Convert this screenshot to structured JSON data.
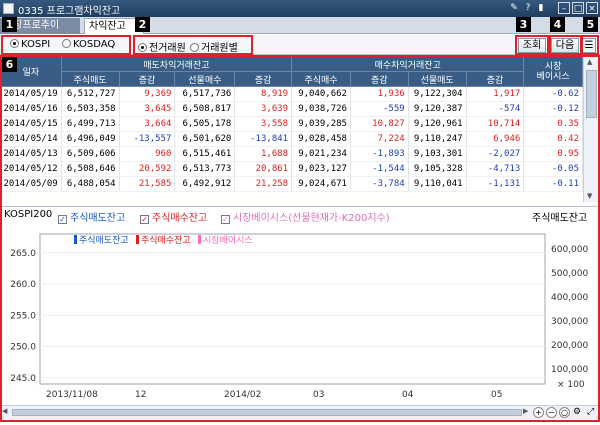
{
  "window": {
    "title": "0335 프로그램차익잔고"
  },
  "tabs": [
    {
      "label": "시장프로추이"
    },
    {
      "label": "차익잔고"
    }
  ],
  "badges": [
    "1",
    "2",
    "3",
    "4",
    "5",
    "6"
  ],
  "options": {
    "market": [
      {
        "label": "KOSPI",
        "selected": true
      },
      {
        "label": "KOSDAQ",
        "selected": false
      }
    ],
    "period": [
      {
        "label": "전거래원",
        "selected": true
      },
      {
        "label": "거래원별",
        "selected": false
      }
    ]
  },
  "buttons": {
    "query": "조회",
    "next": "다음"
  },
  "table": {
    "date_header": "일자",
    "group_headers": [
      "매도차익거래잔고",
      "매수차익거래잔고",
      "시장\n베이시스"
    ],
    "sub_headers": [
      "주식매도",
      "증감",
      "선물매수",
      "증감",
      "주식매수",
      "증감",
      "선물매도",
      "증감"
    ],
    "rows": [
      [
        "2014/05/19",
        "6,512,727",
        "9,369",
        "6,517,736",
        "8,919",
        "9,040,662",
        "1,936",
        "9,122,304",
        "1,917",
        "-0.62"
      ],
      [
        "2014/05/16",
        "6,503,358",
        "3,645",
        "6,508,817",
        "3,639",
        "9,038,726",
        "-559",
        "9,120,387",
        "-574",
        "-0.12"
      ],
      [
        "2014/05/15",
        "6,499,713",
        "3,664",
        "6,505,178",
        "3,558",
        "9,039,285",
        "10,827",
        "9,120,961",
        "10,714",
        "0.35"
      ],
      [
        "2014/05/14",
        "6,496,049",
        "-13,557",
        "6,501,620",
        "-13,841",
        "9,028,458",
        "7,224",
        "9,110,247",
        "6,946",
        "0.42"
      ],
      [
        "2014/05/13",
        "6,509,606",
        "960",
        "6,515,461",
        "1,688",
        "9,021,234",
        "-1,893",
        "9,103,301",
        "-2,027",
        "0.95"
      ],
      [
        "2014/05/12",
        "6,508,646",
        "20,592",
        "6,513,773",
        "20,861",
        "9,023,127",
        "-1,544",
        "9,105,328",
        "-4,713",
        "-0.05"
      ],
      [
        "2014/05/09",
        "6,488,054",
        "21,585",
        "6,492,912",
        "21,258",
        "9,024,671",
        "-3,784",
        "9,110,041",
        "-1,131",
        "-0.11"
      ]
    ]
  },
  "legend": {
    "index_label": "KOSPI200",
    "items": [
      "주식매도잔고",
      "주식매수잔고",
      "시장베이시스(선물현재가-K200지수)"
    ],
    "right_label": "주식매도잔고"
  },
  "chart_data": {
    "type": "line",
    "legend": [
      "주식매도잔고",
      "주식매수잔고",
      "시장베이시스"
    ],
    "x_ticks": [
      "2013/11/08",
      "12",
      "2014/02",
      "03",
      "04",
      "05"
    ],
    "left_axis": {
      "ticks": [
        245.0,
        250.0,
        255.0,
        260.0,
        265.0
      ],
      "ylim": [
        244,
        268
      ]
    },
    "right_axis": {
      "ticks": [
        "100,000",
        "200,000",
        "300,000",
        "400,000",
        "500,000",
        "600,000"
      ],
      "unit": "× 100"
    },
    "colors": {
      "kospi": "#555555",
      "sell": "#1a54c6",
      "buy": "#e02020",
      "basis_pos": "#ff6fb8",
      "basis_neg": "#3fa8e8"
    }
  }
}
